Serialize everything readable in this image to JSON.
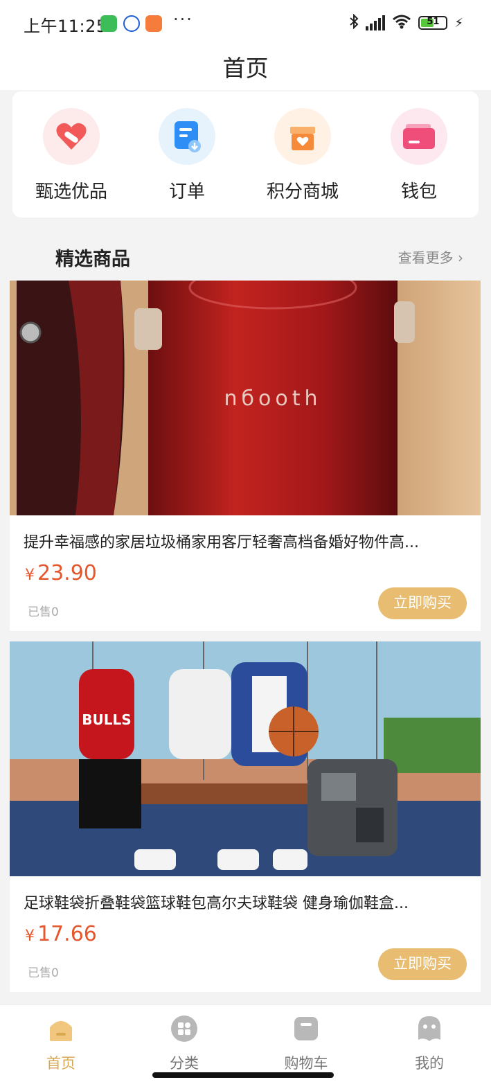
{
  "status_bar": {
    "time": "上午11:25",
    "battery_level": "51",
    "more": "···"
  },
  "header": {
    "title": "首页"
  },
  "quick_entries": [
    {
      "label": "甄选优品",
      "icon": "heart-tag-icon",
      "color": "#f25a5a"
    },
    {
      "label": "订单",
      "icon": "order-doc-icon",
      "color": "#2f8ef5"
    },
    {
      "label": "积分商城",
      "icon": "gift-box-icon",
      "color": "#f58a3a"
    },
    {
      "label": "钱包",
      "icon": "wallet-icon",
      "color": "#f04e7a"
    }
  ],
  "section": {
    "title": "精选商品",
    "see_more": "查看更多 ›"
  },
  "products": [
    {
      "title": "提升幸福感的家居垃圾桶家用客厅轻奢高档备婚好物件高...",
      "currency": "¥",
      "price": "23.90",
      "sold": "已售0",
      "buy_label": "立即购买",
      "image_text": "nбooth"
    },
    {
      "title": "足球鞋袋折叠鞋袋篮球鞋包高尔夫球鞋袋 健身瑜伽鞋盒...",
      "currency": "¥",
      "price": "17.66",
      "sold": "已售0",
      "buy_label": "立即购买",
      "image_text": "BULLS"
    }
  ],
  "tab_bar": {
    "items": [
      {
        "label": "首页",
        "icon": "home-icon",
        "active": true
      },
      {
        "label": "分类",
        "icon": "category-icon",
        "active": false
      },
      {
        "label": "购物车",
        "icon": "cart-icon",
        "active": false
      },
      {
        "label": "我的",
        "icon": "profile-icon",
        "active": false
      }
    ]
  },
  "colors": {
    "accent": "#d8a851",
    "price": "#e5572b",
    "buy_button": "#e8bd72"
  }
}
